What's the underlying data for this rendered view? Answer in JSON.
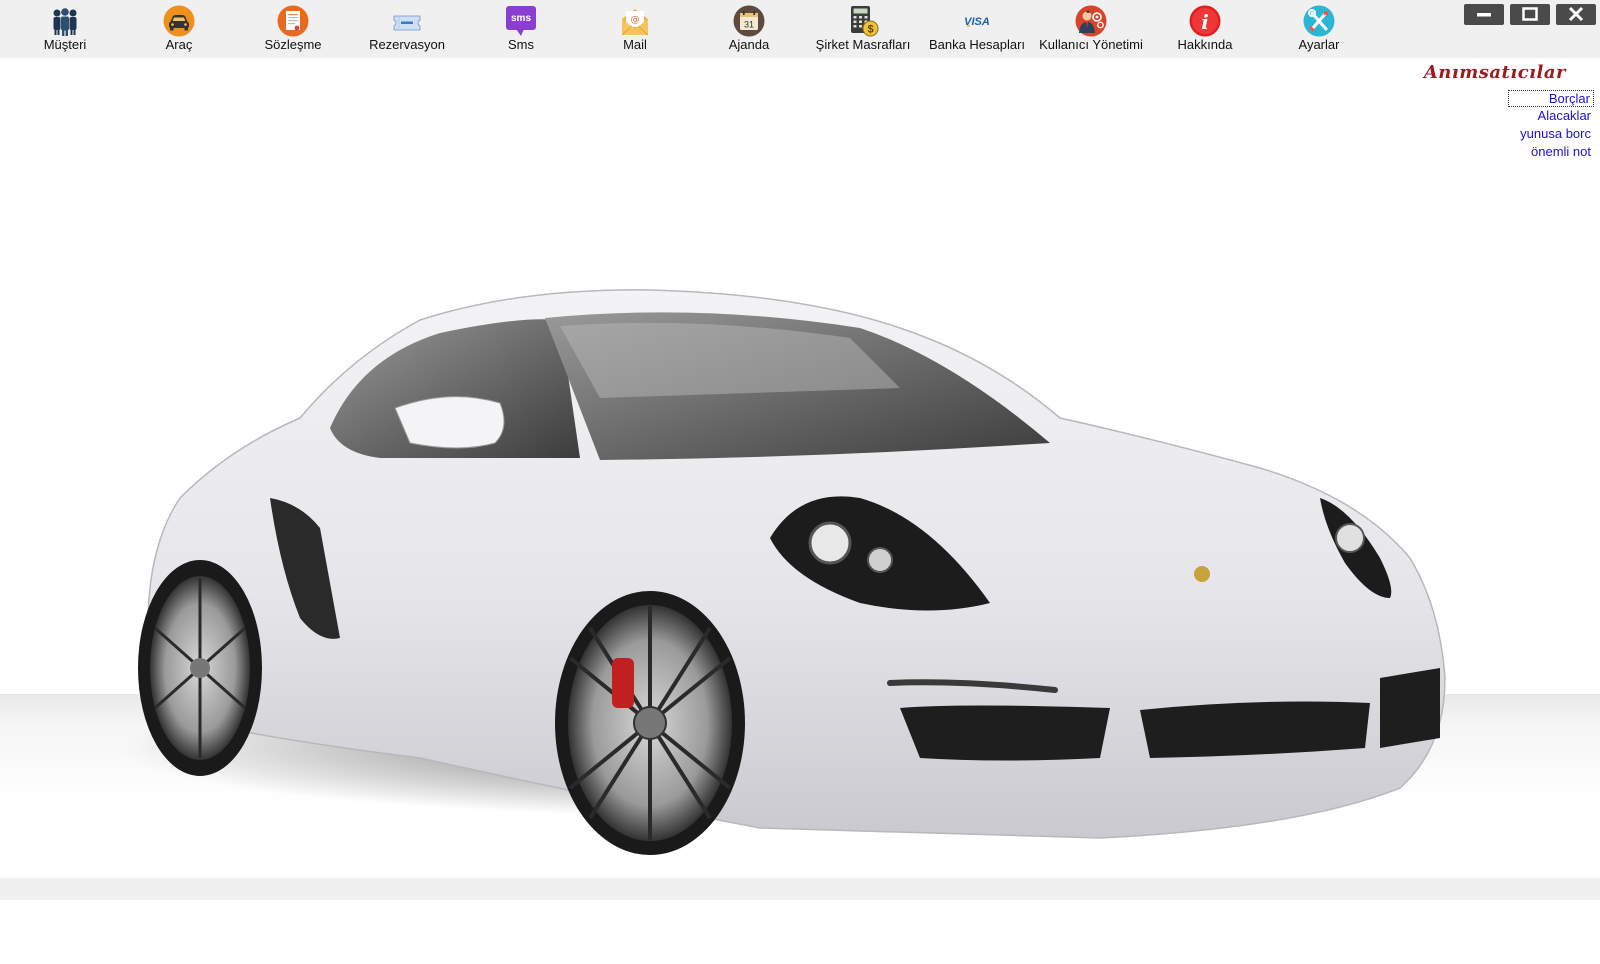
{
  "toolbar": {
    "items": [
      {
        "label": "Müşteri",
        "icon": "customers-icon"
      },
      {
        "label": "Araç",
        "icon": "car-icon"
      },
      {
        "label": "Sözleşme",
        "icon": "contract-icon"
      },
      {
        "label": "Rezervasyon",
        "icon": "reservation-icon"
      },
      {
        "label": "Sms",
        "icon": "sms-icon",
        "icon_text": "sms"
      },
      {
        "label": "Mail",
        "icon": "mail-icon"
      },
      {
        "label": "Ajanda",
        "icon": "calendar-icon",
        "icon_text": "31"
      },
      {
        "label": "Şirket Masrafları",
        "icon": "calculator-icon"
      },
      {
        "label": "Banka Hesapları",
        "icon": "visa-card-icon",
        "icon_text": "VISA"
      },
      {
        "label": "Kullanıcı Yönetimi",
        "icon": "user-management-icon"
      },
      {
        "label": "Hakkında",
        "icon": "info-icon",
        "icon_text": "i"
      },
      {
        "label": "Ayarlar",
        "icon": "settings-tools-icon"
      }
    ]
  },
  "window_controls": [
    "minimize",
    "maximize",
    "close"
  ],
  "reminders": {
    "title": "Anımsatıcılar",
    "links": [
      {
        "label": "Borçlar",
        "focused": true
      },
      {
        "label": "Alacaklar",
        "focused": false
      },
      {
        "label": "yunusa borc",
        "focused": false
      },
      {
        "label": "önemli not",
        "focused": false
      }
    ]
  },
  "colors": {
    "toolbar_bg": "#f0f0f0",
    "link": "#1a10d8",
    "reminders_title": "#9a1d1d",
    "window_button": "#4a4a4a"
  }
}
